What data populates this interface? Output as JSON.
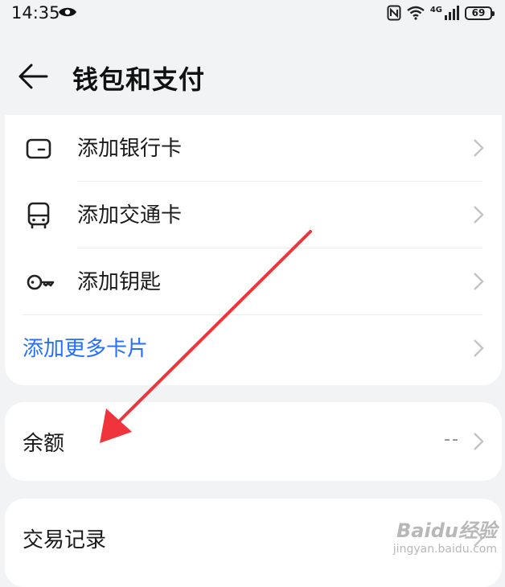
{
  "status_bar": {
    "time": "14:35",
    "network": "4G",
    "battery": "69"
  },
  "header": {
    "title": "钱包和支付"
  },
  "cards_section": {
    "items": [
      {
        "label": "添加银行卡",
        "icon": "bank-card-icon"
      },
      {
        "label": "添加交通卡",
        "icon": "bus-icon"
      },
      {
        "label": "添加钥匙",
        "icon": "key-icon"
      }
    ],
    "more_label": "添加更多卡片"
  },
  "balance": {
    "label": "余额",
    "value": "--"
  },
  "transactions": {
    "label": "交易记录"
  },
  "watermark": {
    "brand": "Baidu经验",
    "url": "jingyan.baidu.com"
  },
  "colors": {
    "accent_blue": "#256fff",
    "annotation_red": "#f0343c",
    "background": "#f1f3f5"
  }
}
